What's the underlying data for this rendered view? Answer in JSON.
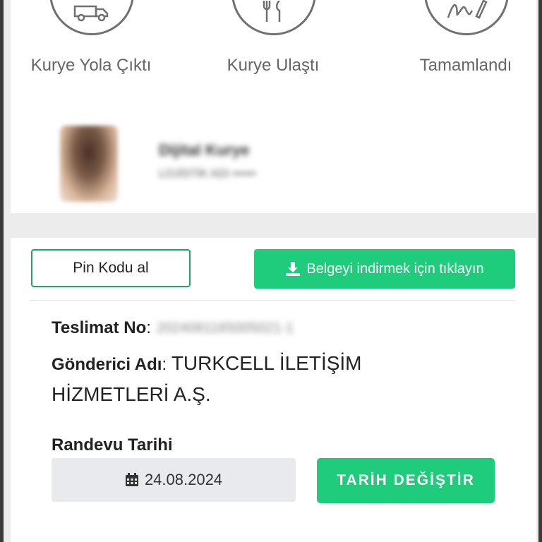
{
  "tracking_steps": [
    {
      "label": "Kurye Yola Çıktı",
      "icon": "delivery-truck-icon"
    },
    {
      "label": "Kurye Ulaştı",
      "icon": "fork-knife-icon"
    },
    {
      "label": "Tamamlandı",
      "icon": "signature-pen-icon"
    }
  ],
  "courier": {
    "name": "Dijital Kurye",
    "subtitle": "LOJİSTİK ADI ••••••"
  },
  "actions": {
    "pin_label": "Pin Kodu al",
    "download_label": "Belgeyi indirmek için tıklayın"
  },
  "delivery": {
    "tracking_label": "Teslimat No",
    "tracking_value": "2024081165005021-1",
    "sender_label": "Gönderici Adı",
    "sender_value_line1": "TURKCELL İLETİŞİM",
    "sender_value_line2": "HİZMETLERİ A.Ş.",
    "appointment_label": "Randevu Tarihi",
    "appointment_date": "24.08.2024",
    "change_date_label": "TARİH DEĞİŞTİR"
  },
  "colors": {
    "primary_green": "#1ecc7c",
    "outline_green": "#1fa56b",
    "icon_gray": "#707070"
  }
}
